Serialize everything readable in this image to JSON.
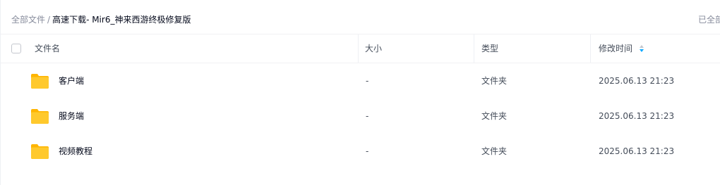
{
  "breadcrumb": {
    "root": "全部文件",
    "separator": "/",
    "current": "高速下载- Mir6_神来西游终极修复版"
  },
  "status": {
    "loaded_text": "已全部加载"
  },
  "table": {
    "headers": {
      "name": "文件名",
      "size": "大小",
      "type": "类型",
      "modified": "修改时间"
    },
    "sort": {
      "column": "modified",
      "icon": "sort-icon"
    },
    "rows": [
      {
        "name": "客户端",
        "size": "-",
        "type": "文件夹",
        "modified": "2025.06.13 21:23",
        "icon": "folder-icon"
      },
      {
        "name": "服务端",
        "size": "-",
        "type": "文件夹",
        "modified": "2025.06.13 21:23",
        "icon": "folder-icon"
      },
      {
        "name": "视频教程",
        "size": "-",
        "type": "文件夹",
        "modified": "2025.06.13 21:23",
        "icon": "folder-icon"
      }
    ]
  },
  "colors": {
    "folder": "#ffc92d",
    "folder_tab": "#ffb500",
    "sort_active": "#06a7ff",
    "sort_inactive": "#c4c7ce"
  }
}
